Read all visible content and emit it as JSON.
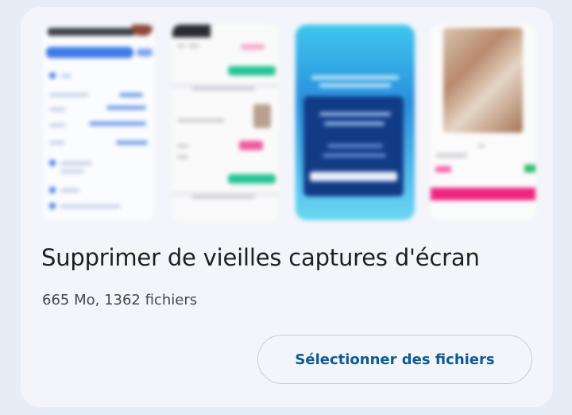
{
  "card": {
    "title": "Supprimer de vieilles captures d'écran",
    "subtitle": "665 Mo, 1362 fichiers",
    "select_button_label": "Sélectionner des fichiers"
  },
  "thumbnails": [
    {
      "name": "screenshot-thumbnail-1"
    },
    {
      "name": "screenshot-thumbnail-2"
    },
    {
      "name": "screenshot-thumbnail-3"
    },
    {
      "name": "screenshot-thumbnail-4"
    }
  ],
  "colors": {
    "background": "#e6edf6",
    "card": "#f3f5fb",
    "button_text": "#0e5b93",
    "button_border": "#c6cbd3"
  }
}
